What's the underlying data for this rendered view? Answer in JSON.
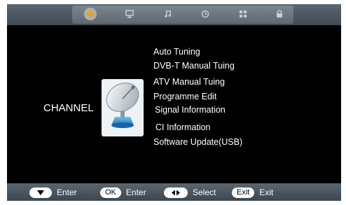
{
  "top_tabs": [
    {
      "icon": "gear-icon",
      "active": true
    },
    {
      "icon": "monitor-icon",
      "active": false
    },
    {
      "icon": "music-note-icon",
      "active": false
    },
    {
      "icon": "clock-icon",
      "active": false
    },
    {
      "icon": "grid-icon",
      "active": false
    },
    {
      "icon": "lock-icon",
      "active": false
    }
  ],
  "section": {
    "title": "CHANNEL",
    "image_icon": "satellite-dish-icon"
  },
  "menu": {
    "items": [
      "Auto Tuning",
      "DVB-T Manual Tuing",
      "ATV Manual Tuing",
      "Programme Edit",
      "Signal Information",
      "CI Information",
      "Software Update(USB)"
    ]
  },
  "bottom_hints": [
    {
      "key_icon": "down-arrow-icon",
      "key_text": "",
      "label": "Enter"
    },
    {
      "key_icon": "",
      "key_text": "OK",
      "label": "Enter"
    },
    {
      "key_icon": "left-right-arrows-icon",
      "key_text": "",
      "label": "Select"
    },
    {
      "key_icon": "",
      "key_text": "Exit",
      "label": "Exit"
    }
  ],
  "colors": {
    "background": "#000000",
    "bar": "#4e5a63",
    "text": "#ffffff",
    "active_icon": "#f0a020"
  }
}
